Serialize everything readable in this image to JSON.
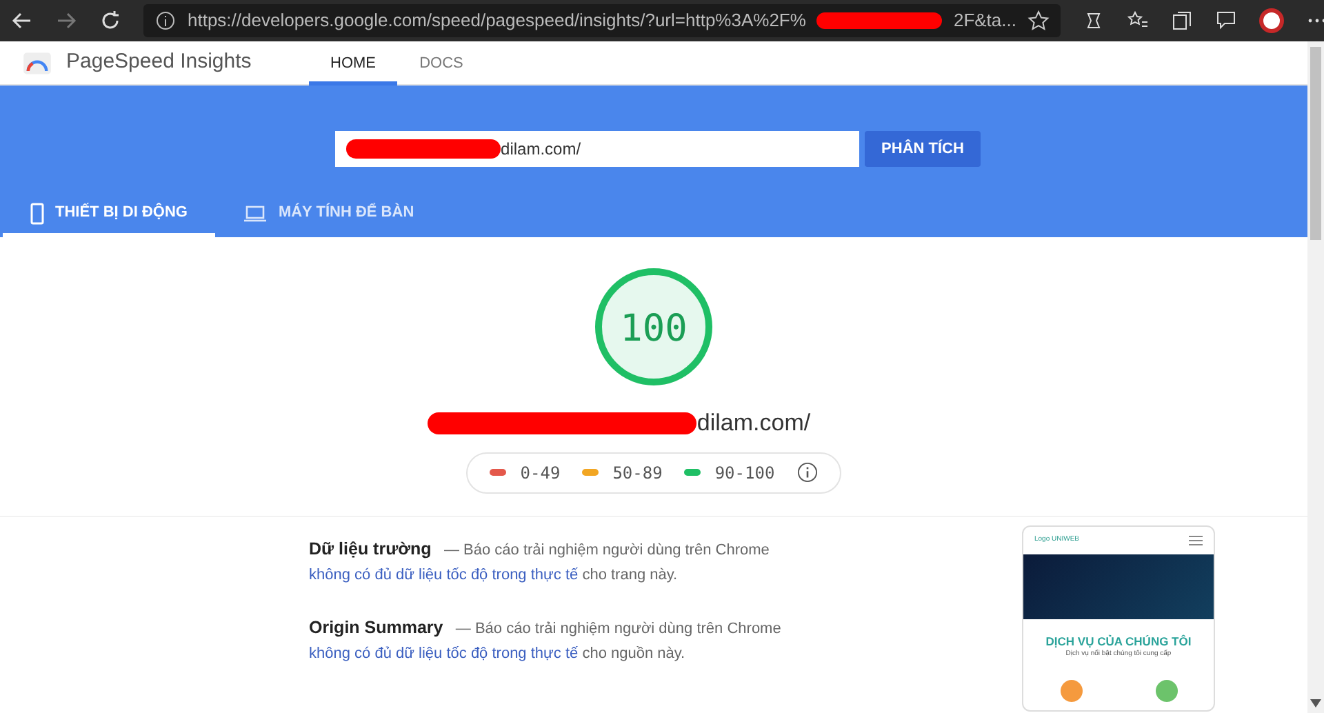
{
  "browser": {
    "url_start": "https://developers.google.com/speed/pagespeed/insights/?url=http%3A%2F%",
    "url_end": "2F&ta...",
    "redacted": true
  },
  "app": {
    "title": "PageSpeed Insights",
    "nav": [
      {
        "label": "HOME",
        "selected": true
      },
      {
        "label": "DOCS",
        "selected": false
      }
    ]
  },
  "search": {
    "value": "dilam.com/",
    "redacted": true,
    "button": "PHÂN TÍCH"
  },
  "device_tabs": [
    {
      "label": "THIẾT BỊ DI ĐỘNG",
      "kind": "mobile",
      "selected": true
    },
    {
      "label": "MÁY TÍNH ĐỂ BÀN",
      "kind": "desktop",
      "selected": false
    }
  ],
  "result": {
    "score": "100",
    "level": 1.0,
    "url": "dilam.com/",
    "redacted": true
  },
  "legend": [
    {
      "range": "0-49",
      "color": "#e4584b"
    },
    {
      "range": "50-89",
      "color": "#f2a623"
    },
    {
      "range": "90-100",
      "color": "#1fbf65"
    }
  ],
  "sections": [
    {
      "title": "Dữ liệu trường",
      "dash": "—",
      "text": "Báo cáo trải nghiệm người dùng trên Chrome",
      "link": "không có đủ dữ liệu tốc độ trong thực tế",
      "after": "cho trang này."
    },
    {
      "title": "Origin Summary",
      "dash": "—",
      "text": "Báo cáo trải nghiệm người dùng trên Chrome",
      "link": "không có đủ dữ liệu tốc độ trong thực tế",
      "after": "cho nguồn này."
    }
  ],
  "preview": {
    "logo": "Logo UNIWEB",
    "heading": "DỊCH VỤ CỦA CHÚNG TÔI",
    "subheading": "Dịch vụ nổi bật chúng tôi cung cấp"
  }
}
